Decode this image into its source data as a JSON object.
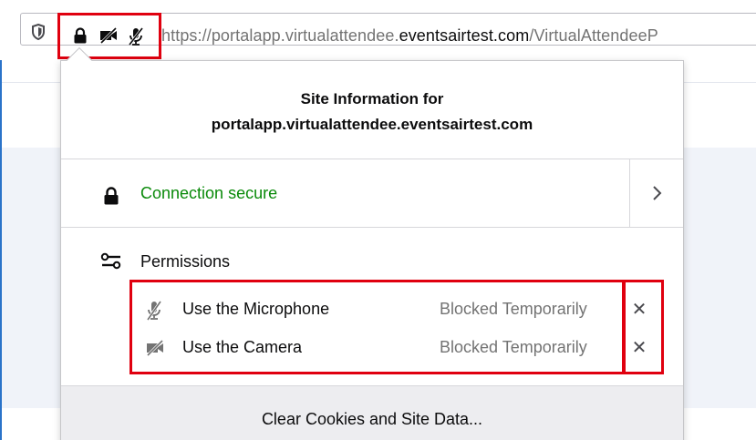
{
  "browser": {
    "url_prefix": "https://portalapp.virtualattendee.",
    "url_domain": "eventsairtest.com",
    "url_suffix": "/VirtualAttendeeP"
  },
  "panel": {
    "title_line1": "Site Information for",
    "title_line2": "portalapp.virtualattendee.eventsairtest.com",
    "connection_label": "Connection secure",
    "permissions_label": "Permissions",
    "permissions": [
      {
        "name": "Use the Microphone",
        "state": "Blocked Temporarily",
        "icon": "microphone-blocked-icon"
      },
      {
        "name": "Use the Camera",
        "state": "Blocked Temporarily",
        "icon": "camera-blocked-icon"
      }
    ],
    "remove_glyph": "✕",
    "clear_button": "Clear Cookies and Site Data..."
  },
  "colors": {
    "secure_green": "#0a8a0a",
    "highlight_red": "#e0000f",
    "muted_text": "#737373"
  }
}
